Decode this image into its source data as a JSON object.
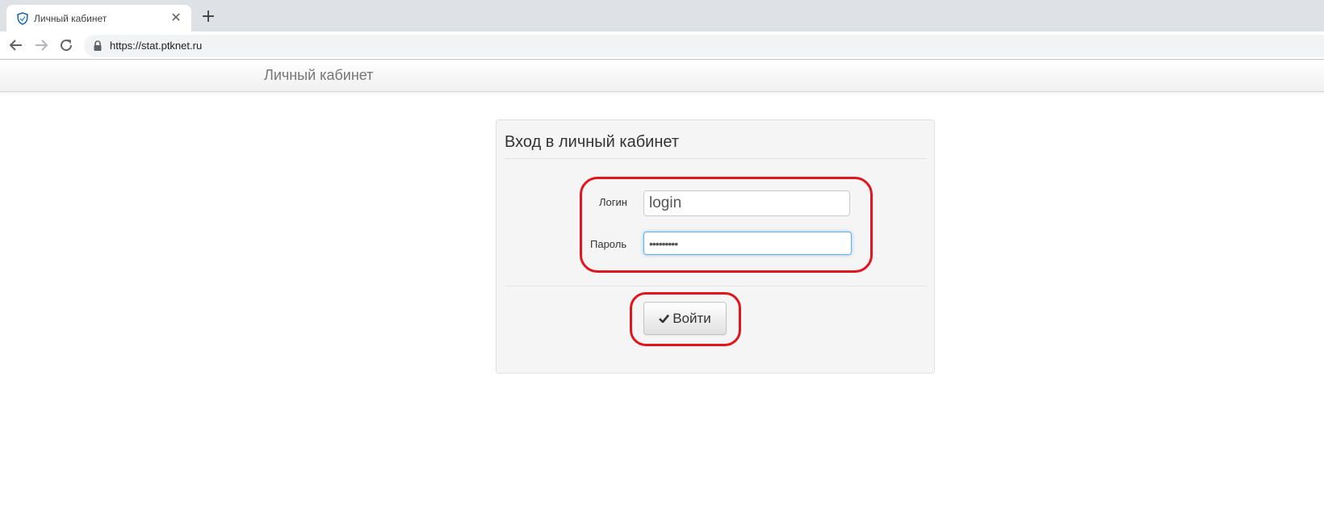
{
  "browser": {
    "tab": {
      "title": "Личный кабинет",
      "close_symbol": "✕"
    },
    "new_tab_symbol": "+",
    "address": {
      "url": "https://stat.ptknet.ru"
    },
    "icons": {
      "favicon": "shield-favicon-icon",
      "back": "arrow-left-icon",
      "forward": "arrow-right-icon",
      "reload": "reload-icon",
      "lock": "lock-icon"
    }
  },
  "navbar": {
    "brand": "Личный кабинет"
  },
  "login": {
    "title": "Вход в личный кабинет",
    "login_label": "Логин",
    "login_value": "login",
    "password_label": "Пароль",
    "password_value": "•••••••••",
    "submit_label": "Войти",
    "submit_icon": "check-icon"
  },
  "colors": {
    "annotation": "#e3151c",
    "focus_ring": "#66afe9",
    "panel_bg": "#f5f5f5",
    "tabstrip_bg": "#dee1e6"
  }
}
